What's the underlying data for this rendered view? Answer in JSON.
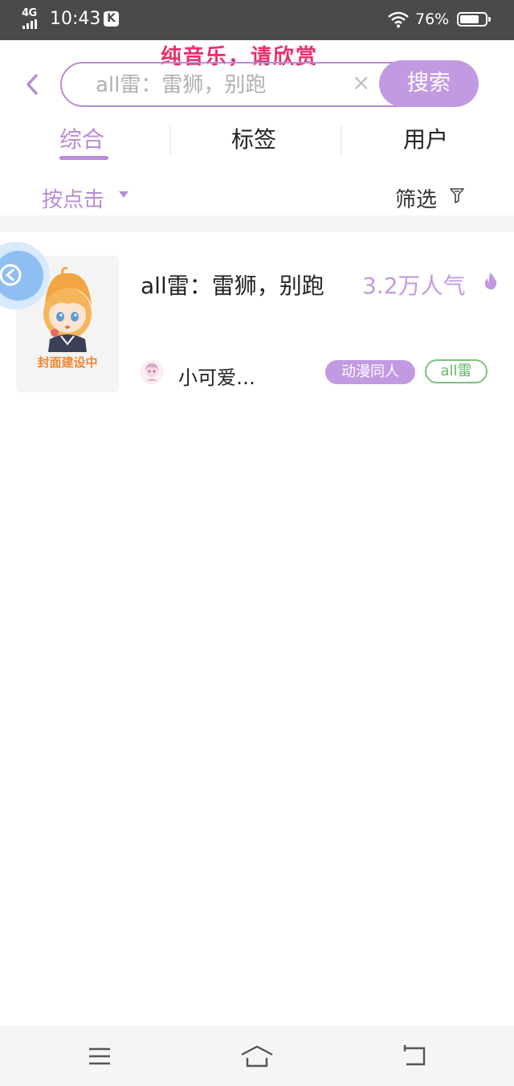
{
  "status_bar": {
    "network": "4G",
    "time": "10:43",
    "app_badge": "K",
    "battery": "76%",
    "battery_level": 0.76
  },
  "marquee": "纯音乐，请欣赏",
  "search": {
    "placeholder": "all雷：雷狮，别跑",
    "clear": "×",
    "button_label": "搜索"
  },
  "tabs": [
    {
      "label": "综合",
      "active": true
    },
    {
      "label": "标签",
      "active": false
    },
    {
      "label": "用户",
      "active": false
    }
  ],
  "sort": {
    "label": "按点击"
  },
  "filter": {
    "label": "筛选"
  },
  "results": [
    {
      "cover_caption": "封面建设中",
      "title": "all雷：雷狮，别跑",
      "popularity": "3.2万人气",
      "author": "小可爱…",
      "tags": [
        "动漫同人",
        "all雷"
      ]
    }
  ],
  "icons": {
    "back": "chevron-left-icon",
    "filter": "filter-icon",
    "popularity": "fire-icon",
    "float": "close-icon",
    "nav": [
      "menu-icon",
      "home-icon",
      "back-icon"
    ]
  },
  "colors": {
    "accent": "#c29ae2",
    "marquee": "#e8306a",
    "tag_outline": "#7cc17f",
    "cover_caption": "#f08732"
  }
}
